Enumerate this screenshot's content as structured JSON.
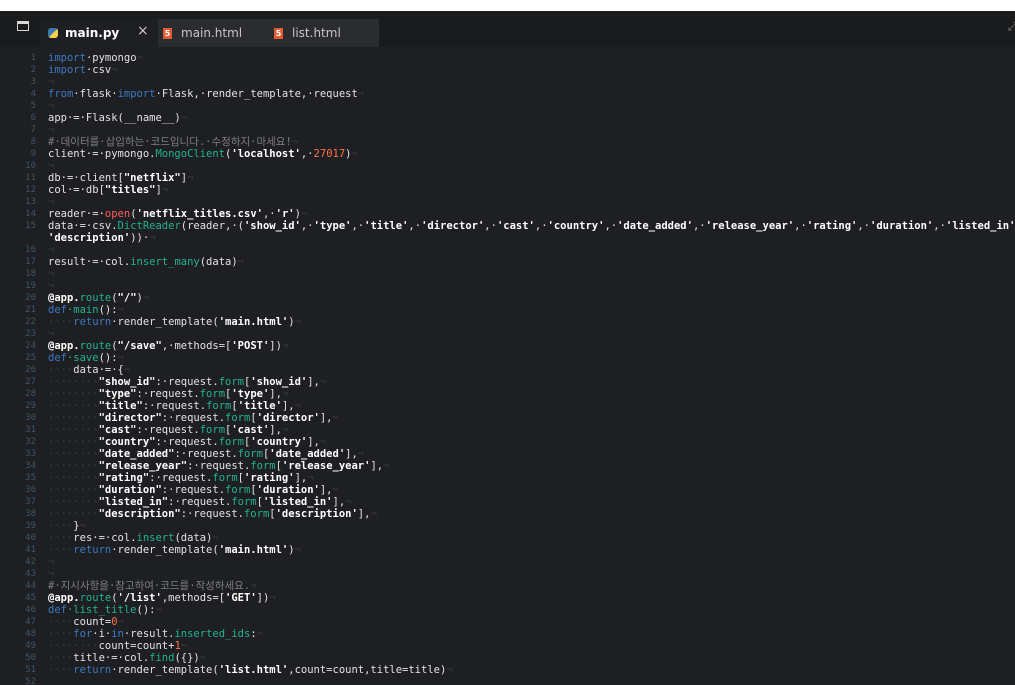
{
  "tabs": [
    {
      "label": "main.py",
      "active": true,
      "icon": "python-icon"
    },
    {
      "label": "main.html",
      "active": false,
      "icon": "html5-icon"
    },
    {
      "label": "list.html",
      "active": false,
      "icon": "html5-icon"
    }
  ],
  "icons": {
    "sidebar": "folder-icon",
    "close": "×",
    "html_badge": "5"
  },
  "colors": {
    "keyword": "#3d79c4",
    "function": "#22b391",
    "string": "#ffffff",
    "number": "#ff7043",
    "comment": "#7d7f84"
  },
  "code_lines": [
    {
      "n": "1",
      "t": [
        [
          "kw",
          "import"
        ],
        [
          "",
          "·pymongo"
        ],
        [
          "ws",
          "¬"
        ]
      ]
    },
    {
      "n": "2",
      "t": [
        [
          "kw",
          "import"
        ],
        [
          "",
          "·csv"
        ],
        [
          "ws",
          "¬"
        ]
      ]
    },
    {
      "n": "3",
      "t": [
        [
          "ws",
          "¬"
        ]
      ]
    },
    {
      "n": "4",
      "t": [
        [
          "kw",
          "from"
        ],
        [
          "",
          "·flask·"
        ],
        [
          "kw",
          "import"
        ],
        [
          "",
          "·Flask,·render_template,·request"
        ],
        [
          "ws",
          "¬"
        ]
      ]
    },
    {
      "n": "5",
      "t": [
        [
          "ws",
          "¬"
        ]
      ]
    },
    {
      "n": "6",
      "t": [
        [
          "",
          "app·=·Flask(__name__)"
        ],
        [
          "ws",
          "¬"
        ]
      ]
    },
    {
      "n": "7",
      "t": [
        [
          "ws",
          "¬"
        ]
      ]
    },
    {
      "n": "8",
      "t": [
        [
          "cm",
          "#·데이터를·삽입하는·코드입니다.·수정하지·마세요!"
        ],
        [
          "ws",
          "¬"
        ]
      ]
    },
    {
      "n": "9",
      "t": [
        [
          "",
          "client·=·pymongo."
        ],
        [
          "fn",
          "MongoClient"
        ],
        [
          "",
          "("
        ],
        [
          "str",
          "'localhost'"
        ],
        [
          "",
          ",·"
        ],
        [
          "num",
          "27017"
        ],
        [
          "",
          ")"
        ],
        [
          "ws",
          "¬"
        ]
      ]
    },
    {
      "n": "10",
      "t": [
        [
          "ws",
          "¬"
        ]
      ]
    },
    {
      "n": "11",
      "t": [
        [
          "",
          "db·=·client["
        ],
        [
          "str",
          "\"netflix\""
        ],
        [
          "",
          "]"
        ],
        [
          "ws",
          "¬"
        ]
      ]
    },
    {
      "n": "12",
      "t": [
        [
          "",
          "col·=·db["
        ],
        [
          "str",
          "\"titles\""
        ],
        [
          "",
          "]"
        ],
        [
          "ws",
          "¬"
        ]
      ]
    },
    {
      "n": "13",
      "t": [
        [
          "ws",
          "¬"
        ]
      ]
    },
    {
      "n": "14",
      "t": [
        [
          "",
          "reader·=·"
        ],
        [
          "op",
          "open"
        ],
        [
          "",
          "("
        ],
        [
          "str",
          "'netflix_titles.csv'"
        ],
        [
          "",
          ",·"
        ],
        [
          "str",
          "'r'"
        ],
        [
          "",
          ")"
        ],
        [
          "ws",
          "¬"
        ]
      ]
    },
    {
      "n": "15",
      "t": [
        [
          "",
          "data·=·csv."
        ],
        [
          "fn",
          "DictReader"
        ],
        [
          "",
          "(reader,·("
        ],
        [
          "str",
          "'show_id'"
        ],
        [
          "",
          ",·"
        ],
        [
          "str",
          "'type'"
        ],
        [
          "",
          ",·"
        ],
        [
          "str",
          "'title'"
        ],
        [
          "",
          ",·"
        ],
        [
          "str",
          "'director'"
        ],
        [
          "",
          ",·"
        ],
        [
          "str",
          "'cast'"
        ],
        [
          "",
          ",·"
        ],
        [
          "str",
          "'country'"
        ],
        [
          "",
          ",·"
        ],
        [
          "str",
          "'date_added'"
        ],
        [
          "",
          ",·"
        ],
        [
          "str",
          "'release_year'"
        ],
        [
          "",
          ",·"
        ],
        [
          "str",
          "'rating'"
        ],
        [
          "",
          ",·"
        ],
        [
          "str",
          "'duration'"
        ],
        [
          "",
          ",·"
        ],
        [
          "str",
          "'listed_in'"
        ],
        [
          "",
          ","
        ]
      ]
    },
    {
      "n": "",
      "t": [
        [
          "str",
          "'description'"
        ],
        [
          "",
          "))·"
        ],
        [
          "ws",
          "¬"
        ]
      ]
    },
    {
      "n": "16",
      "t": [
        [
          "ws",
          "¬"
        ]
      ]
    },
    {
      "n": "17",
      "t": [
        [
          "",
          "result·=·col."
        ],
        [
          "fn",
          "insert_many"
        ],
        [
          "",
          "(data)"
        ],
        [
          "ws",
          "¬"
        ]
      ]
    },
    {
      "n": "18",
      "t": [
        [
          "ws",
          "¬"
        ]
      ]
    },
    {
      "n": "19",
      "t": [
        [
          "ws",
          "¬"
        ]
      ]
    },
    {
      "n": "20",
      "t": [
        [
          "dec",
          "@app."
        ],
        [
          "fn",
          "route"
        ],
        [
          "",
          "("
        ],
        [
          "str",
          "\"/\""
        ],
        [
          "",
          ")"
        ],
        [
          "ws",
          "¬"
        ]
      ]
    },
    {
      "n": "21",
      "t": [
        [
          "kw",
          "def"
        ],
        [
          "",
          ""
        ],
        [
          "fn",
          "·main"
        ],
        [
          "",
          "():"
        ],
        [
          "ws",
          "¬"
        ]
      ]
    },
    {
      "n": "22",
      "t": [
        [
          "ws",
          "····"
        ],
        [
          "kw",
          "return"
        ],
        [
          "",
          "·render_template("
        ],
        [
          "str",
          "'main.html'"
        ],
        [
          "",
          ")"
        ],
        [
          "ws",
          "¬"
        ]
      ]
    },
    {
      "n": "23",
      "t": [
        [
          "ws",
          "¬"
        ]
      ]
    },
    {
      "n": "24",
      "t": [
        [
          "dec",
          "@app."
        ],
        [
          "fn",
          "route"
        ],
        [
          "",
          "("
        ],
        [
          "str",
          "\"/save\""
        ],
        [
          "",
          ",·methods=["
        ],
        [
          "str",
          "'POST'"
        ],
        [
          "",
          "])"
        ],
        [
          "ws",
          "¬"
        ]
      ]
    },
    {
      "n": "25",
      "t": [
        [
          "kw",
          "def"
        ],
        [
          "fn",
          "·save"
        ],
        [
          "",
          "():"
        ],
        [
          "ws",
          "¬"
        ]
      ]
    },
    {
      "n": "26",
      "t": [
        [
          "ws",
          "····"
        ],
        [
          "",
          "data·=·{"
        ],
        [
          "ws",
          "¬"
        ]
      ]
    },
    {
      "n": "27",
      "t": [
        [
          "ws",
          "········"
        ],
        [
          "str",
          "\"show_id\""
        ],
        [
          "",
          ":·request."
        ],
        [
          "fn",
          "form"
        ],
        [
          "",
          "["
        ],
        [
          "str",
          "'show_id'"
        ],
        [
          "",
          "],"
        ],
        [
          "ws",
          "¬"
        ]
      ]
    },
    {
      "n": "28",
      "t": [
        [
          "ws",
          "········"
        ],
        [
          "str",
          "\"type\""
        ],
        [
          "",
          ":·request."
        ],
        [
          "fn",
          "form"
        ],
        [
          "",
          "["
        ],
        [
          "str",
          "'type'"
        ],
        [
          "",
          "],"
        ],
        [
          "ws",
          "¬"
        ]
      ]
    },
    {
      "n": "29",
      "t": [
        [
          "ws",
          "········"
        ],
        [
          "str",
          "\"title\""
        ],
        [
          "",
          ":·request."
        ],
        [
          "fn",
          "form"
        ],
        [
          "",
          "["
        ],
        [
          "str",
          "'title'"
        ],
        [
          "",
          "],"
        ],
        [
          "ws",
          "¬"
        ]
      ]
    },
    {
      "n": "30",
      "t": [
        [
          "ws",
          "········"
        ],
        [
          "str",
          "\"director\""
        ],
        [
          "",
          ":·request."
        ],
        [
          "fn",
          "form"
        ],
        [
          "",
          "["
        ],
        [
          "str",
          "'director'"
        ],
        [
          "",
          "],"
        ],
        [
          "ws",
          "¬"
        ]
      ]
    },
    {
      "n": "31",
      "t": [
        [
          "ws",
          "········"
        ],
        [
          "str",
          "\"cast\""
        ],
        [
          "",
          ":·request."
        ],
        [
          "fn",
          "form"
        ],
        [
          "",
          "["
        ],
        [
          "str",
          "'cast'"
        ],
        [
          "",
          "],"
        ],
        [
          "ws",
          "¬"
        ]
      ]
    },
    {
      "n": "32",
      "t": [
        [
          "ws",
          "········"
        ],
        [
          "str",
          "\"country\""
        ],
        [
          "",
          ":·request."
        ],
        [
          "fn",
          "form"
        ],
        [
          "",
          "["
        ],
        [
          "str",
          "'country'"
        ],
        [
          "",
          "],"
        ],
        [
          "ws",
          "¬"
        ]
      ]
    },
    {
      "n": "33",
      "t": [
        [
          "ws",
          "········"
        ],
        [
          "str",
          "\"date_added\""
        ],
        [
          "",
          ":·request."
        ],
        [
          "fn",
          "form"
        ],
        [
          "",
          "["
        ],
        [
          "str",
          "'date_added'"
        ],
        [
          "",
          "],"
        ],
        [
          "ws",
          "¬"
        ]
      ]
    },
    {
      "n": "34",
      "t": [
        [
          "ws",
          "········"
        ],
        [
          "str",
          "\"release_year\""
        ],
        [
          "",
          ":·request."
        ],
        [
          "fn",
          "form"
        ],
        [
          "",
          "["
        ],
        [
          "str",
          "'release_year'"
        ],
        [
          "",
          "],"
        ],
        [
          "ws",
          "¬"
        ]
      ]
    },
    {
      "n": "35",
      "t": [
        [
          "ws",
          "········"
        ],
        [
          "str",
          "\"rating\""
        ],
        [
          "",
          ":·request."
        ],
        [
          "fn",
          "form"
        ],
        [
          "",
          "["
        ],
        [
          "str",
          "'rating'"
        ],
        [
          "",
          "],"
        ],
        [
          "ws",
          "¬"
        ]
      ]
    },
    {
      "n": "36",
      "t": [
        [
          "ws",
          "········"
        ],
        [
          "str",
          "\"duration\""
        ],
        [
          "",
          ":·request."
        ],
        [
          "fn",
          "form"
        ],
        [
          "",
          "["
        ],
        [
          "str",
          "'duration'"
        ],
        [
          "",
          "],"
        ],
        [
          "ws",
          "¬"
        ]
      ]
    },
    {
      "n": "37",
      "t": [
        [
          "ws",
          "········"
        ],
        [
          "str",
          "\"listed_in\""
        ],
        [
          "",
          ":·request."
        ],
        [
          "fn",
          "form"
        ],
        [
          "",
          "["
        ],
        [
          "str",
          "'listed_in'"
        ],
        [
          "",
          "],"
        ],
        [
          "ws",
          "¬"
        ]
      ]
    },
    {
      "n": "38",
      "t": [
        [
          "ws",
          "········"
        ],
        [
          "str",
          "\"description\""
        ],
        [
          "",
          ":·request."
        ],
        [
          "fn",
          "form"
        ],
        [
          "",
          "["
        ],
        [
          "str",
          "'description'"
        ],
        [
          "",
          "],"
        ],
        [
          "ws",
          "¬"
        ]
      ]
    },
    {
      "n": "39",
      "t": [
        [
          "ws",
          "····"
        ],
        [
          "",
          "}"
        ],
        [
          "ws",
          "¬"
        ]
      ]
    },
    {
      "n": "40",
      "t": [
        [
          "ws",
          "····"
        ],
        [
          "",
          "res·=·col."
        ],
        [
          "fn",
          "insert"
        ],
        [
          "",
          "(data)"
        ],
        [
          "ws",
          "¬"
        ]
      ]
    },
    {
      "n": "41",
      "t": [
        [
          "ws",
          "····"
        ],
        [
          "kw",
          "return"
        ],
        [
          "",
          "·render_template("
        ],
        [
          "str",
          "'main.html'"
        ],
        [
          "",
          ")"
        ],
        [
          "ws",
          "¬"
        ]
      ]
    },
    {
      "n": "42",
      "t": [
        [
          "ws",
          "¬"
        ]
      ]
    },
    {
      "n": "43",
      "t": [
        [
          "ws",
          "¬"
        ]
      ]
    },
    {
      "n": "44",
      "t": [
        [
          "cm",
          "#·지시사항을·참고하여·코드를·작성하세요."
        ],
        [
          "ws",
          "¬"
        ]
      ]
    },
    {
      "n": "45",
      "t": [
        [
          "dec",
          "@app."
        ],
        [
          "fn",
          "route"
        ],
        [
          "",
          "("
        ],
        [
          "str",
          "'/list'"
        ],
        [
          "",
          ",methods=["
        ],
        [
          "str",
          "'GET'"
        ],
        [
          "",
          "])"
        ],
        [
          "ws",
          "¬"
        ]
      ]
    },
    {
      "n": "46",
      "t": [
        [
          "kw",
          "def"
        ],
        [
          "fn",
          "·list_title"
        ],
        [
          "",
          "():"
        ],
        [
          "ws",
          "¬"
        ]
      ]
    },
    {
      "n": "47",
      "t": [
        [
          "ws",
          "····"
        ],
        [
          "",
          "count="
        ],
        [
          "num",
          "0"
        ],
        [
          "ws",
          "¬"
        ]
      ]
    },
    {
      "n": "48",
      "t": [
        [
          "ws",
          "····"
        ],
        [
          "kw",
          "for"
        ],
        [
          "",
          "·i·"
        ],
        [
          "kw",
          "in"
        ],
        [
          "",
          "·result."
        ],
        [
          "fn",
          "inserted_ids"
        ],
        [
          "",
          ":"
        ],
        [
          "ws",
          "¬"
        ]
      ]
    },
    {
      "n": "49",
      "t": [
        [
          "ws",
          "········"
        ],
        [
          "",
          "count=count+"
        ],
        [
          "num",
          "1"
        ],
        [
          "ws",
          "¬"
        ]
      ]
    },
    {
      "n": "50",
      "t": [
        [
          "ws",
          "····"
        ],
        [
          "",
          "title·=·col."
        ],
        [
          "fn",
          "find"
        ],
        [
          "",
          "({})"
        ],
        [
          "ws",
          "¬"
        ]
      ]
    },
    {
      "n": "51",
      "t": [
        [
          "ws",
          "····"
        ],
        [
          "kw",
          "return"
        ],
        [
          "",
          "·render_template("
        ],
        [
          "str",
          "'list.html'"
        ],
        [
          "",
          ",count=count,title=title)"
        ],
        [
          "ws",
          "¬"
        ]
      ]
    },
    {
      "n": "52",
      "t": []
    }
  ]
}
